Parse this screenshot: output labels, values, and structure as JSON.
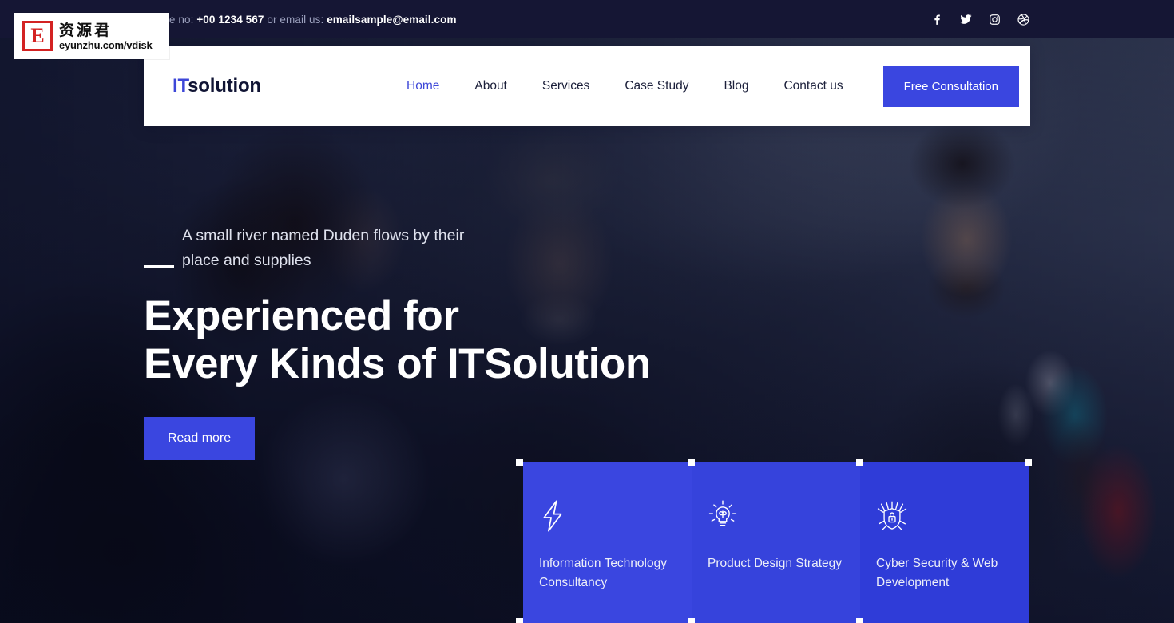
{
  "topbar": {
    "contact_prefix": "Phone no:",
    "phone": "+00 1234 567",
    "contact_middle": "or email us:",
    "email": "emailsample@email.com",
    "social": [
      {
        "name": "facebook-icon",
        "label": "Facebook"
      },
      {
        "name": "twitter-icon",
        "label": "Twitter"
      },
      {
        "name": "instagram-icon",
        "label": "Instagram"
      },
      {
        "name": "dribbble-icon",
        "label": "Dribbble"
      }
    ],
    "bg_color": "#151634"
  },
  "header": {
    "brand_first": "IT",
    "brand_second": "solution",
    "menu": [
      {
        "label": "Home",
        "active": true
      },
      {
        "label": "About",
        "active": false
      },
      {
        "label": "Services",
        "active": false
      },
      {
        "label": "Case Study",
        "active": false
      },
      {
        "label": "Blog",
        "active": false
      },
      {
        "label": "Contact us",
        "active": false
      }
    ],
    "cta_label": "Free Consultation",
    "accent_color": "#3d47d8"
  },
  "hero": {
    "subtitle_line1": "A small river named Duden flows by",
    "subtitle_line2": "their place and supplies",
    "title_line1": "Experienced for",
    "title_line2": "Every Kinds of ITSolution",
    "button_label": "Read more",
    "button_color": "#3a46e0"
  },
  "cards": [
    {
      "icon": "lightning-bolt-icon",
      "label": "Information Technology Consultancy",
      "bg": "#3a46e0"
    },
    {
      "icon": "lightbulb-idea-icon",
      "label": "Product Design Strategy",
      "bg": "#3643dc"
    },
    {
      "icon": "shield-lock-security-icon",
      "label": "Cyber Security & Web Development",
      "bg": "#2f3cd8"
    }
  ],
  "watermark": {
    "logo_letter": "E",
    "chinese": "资源君",
    "url": "eyunzhu.com/vdisk"
  }
}
